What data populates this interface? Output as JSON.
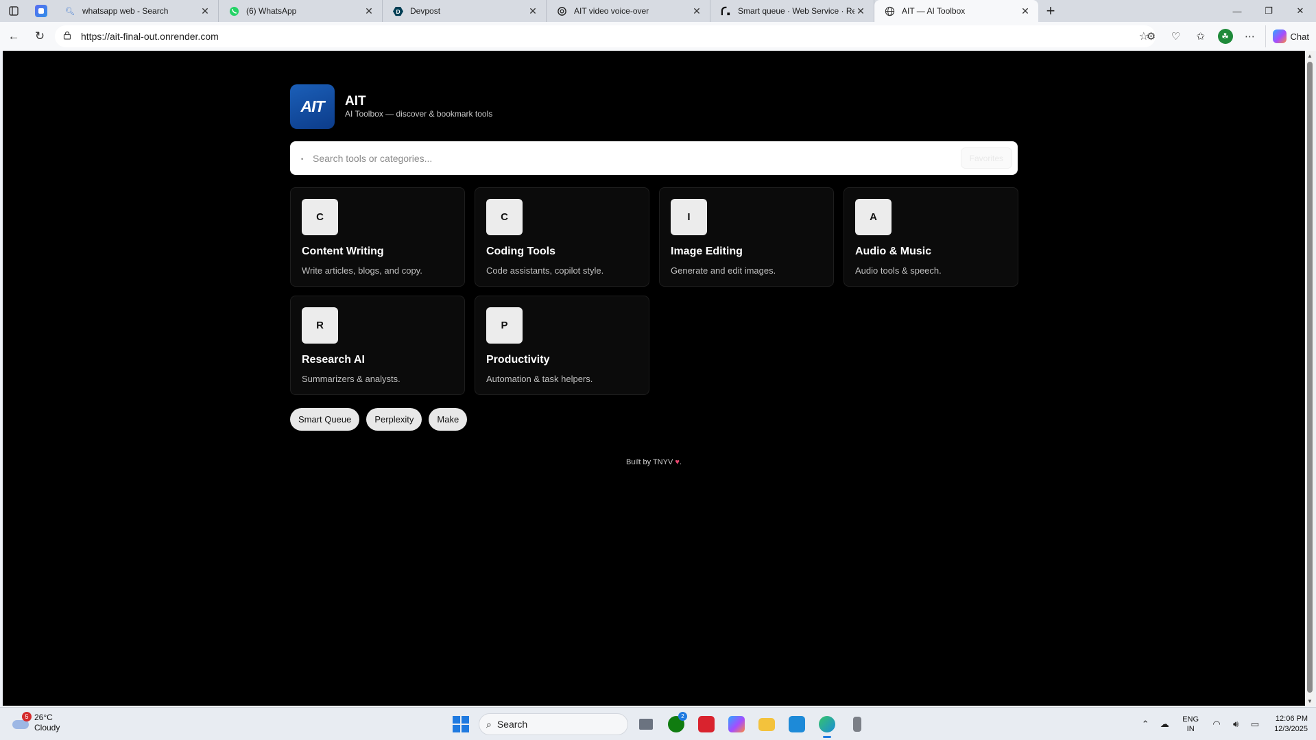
{
  "browser": {
    "tabs": [
      {
        "title": "whatsapp web - Search",
        "icon": "search-icon",
        "active": false
      },
      {
        "title": "(6) WhatsApp",
        "icon": "whatsapp-icon",
        "active": false
      },
      {
        "title": "Devpost",
        "icon": "devpost-icon",
        "active": false
      },
      {
        "title": "AIT video voice-over",
        "icon": "openai-icon",
        "active": false
      },
      {
        "title": "Smart queue · Web Service · Ren",
        "icon": "render-icon",
        "active": false
      },
      {
        "title": "AIT — AI Toolbox",
        "icon": "globe-icon",
        "active": true
      }
    ],
    "url": "https://ait-final-out.onrender.com",
    "chat_label": "Chat"
  },
  "app": {
    "logo_text": "AIT",
    "name": "AIT",
    "tagline": "AI Toolbox — discover & bookmark tools",
    "search_placeholder": "Search tools or categories...",
    "favorites_label": "Favorites",
    "categories": [
      {
        "letter": "C",
        "name": "Content Writing",
        "desc": "Write articles, blogs, and copy."
      },
      {
        "letter": "C",
        "name": "Coding Tools",
        "desc": "Code assistants, copilot style."
      },
      {
        "letter": "I",
        "name": "Image Editing",
        "desc": "Generate and edit images."
      },
      {
        "letter": "A",
        "name": "Audio & Music",
        "desc": "Audio tools & speech."
      },
      {
        "letter": "R",
        "name": "Research AI",
        "desc": "Summarizers & analysts."
      },
      {
        "letter": "P",
        "name": "Productivity",
        "desc": "Automation & task helpers."
      }
    ],
    "chips": [
      "Smart Queue",
      "Perplexity",
      "Make"
    ],
    "footer_prefix": "Built by TNYV",
    "footer_suffix": "."
  },
  "taskbar": {
    "temperature": "26°C",
    "condition": "Cloudy",
    "weather_badge": "5",
    "search_label": "Search",
    "xbox_badge": "2",
    "lang_line1": "ENG",
    "lang_line2": "IN",
    "time": "12:06 PM",
    "date": "12/3/2025"
  },
  "colors": {
    "page_bg": "#000000",
    "logo_blue": "#1b5fb8",
    "accent_blue": "#1f7ae0",
    "heart": "#e8466f"
  }
}
